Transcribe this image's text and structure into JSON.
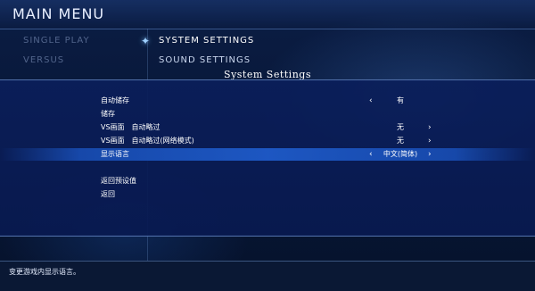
{
  "header": {
    "title": "MAIN MENU"
  },
  "left_menu": [
    "SINGLE PLAY",
    "VERSUS"
  ],
  "sub_menu": {
    "selected": "SYSTEM SETTINGS",
    "items": [
      "SOUND SETTINGS"
    ]
  },
  "dialog": {
    "title": "System Settings",
    "rows": [
      {
        "label": "自动储存",
        "value": "有",
        "left_arrow": "‹",
        "right_arrow": ""
      },
      {
        "label": "储存",
        "value": "",
        "left_arrow": "",
        "right_arrow": ""
      },
      {
        "label": "VS画面　自动略过",
        "value": "无",
        "left_arrow": "",
        "right_arrow": "›"
      },
      {
        "label": "VS画面　自动略过(网络模式)",
        "value": "无",
        "left_arrow": "",
        "right_arrow": "›"
      },
      {
        "label": "显示语言",
        "value": "中文(简体)",
        "left_arrow": "‹",
        "right_arrow": "›"
      },
      {
        "label": "返回预设值",
        "value": "",
        "left_arrow": "",
        "right_arrow": ""
      },
      {
        "label": "返回",
        "value": "",
        "left_arrow": "",
        "right_arrow": ""
      }
    ]
  },
  "footer": {
    "help_text": "变更游戏内显示语言。"
  },
  "colors": {
    "background": "#061433",
    "highlight": "#1e5ac8",
    "text": "#ffffff"
  }
}
